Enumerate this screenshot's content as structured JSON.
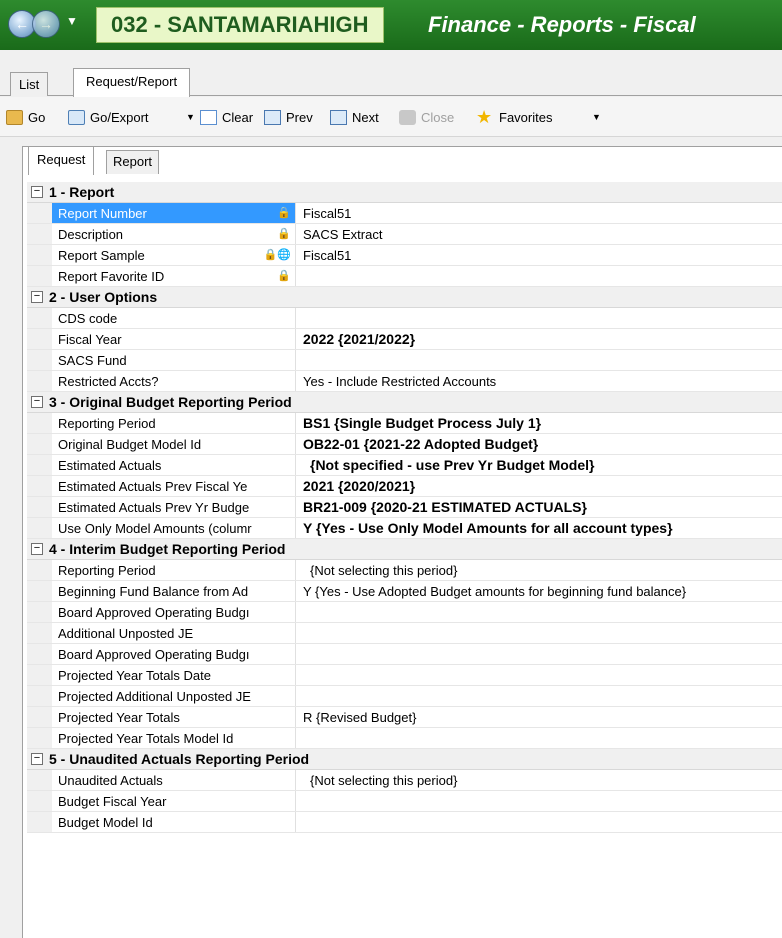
{
  "titlebar": {
    "district": "032 - SANTAMARIAHIGH",
    "module": "Finance - Reports - Fiscal",
    "back_icon": "back-arrow-icon",
    "forward_icon": "forward-arrow-icon"
  },
  "outer_tabs": {
    "list": "List",
    "request_report": "Request/Report"
  },
  "toolbar": {
    "go": "Go",
    "go_export": "Go/Export",
    "clear": "Clear",
    "prev": "Prev",
    "next": "Next",
    "close": "Close",
    "favorites": "Favorites"
  },
  "inner_tabs": {
    "request": "Request",
    "report": "Report"
  },
  "sections": {
    "s1": {
      "title": "1 - Report",
      "rows": [
        {
          "name": "Report Number",
          "value": "Fiscal51"
        },
        {
          "name": "Description",
          "value": "SACS Extract"
        },
        {
          "name": "Report Sample",
          "value": "Fiscal51"
        },
        {
          "name": "Report Favorite ID",
          "value": ""
        }
      ]
    },
    "s2": {
      "title": "2 - User Options",
      "rows": [
        {
          "name": "CDS code",
          "value": ""
        },
        {
          "name": "Fiscal Year",
          "value": "2022 {2021/2022}"
        },
        {
          "name": "SACS Fund",
          "value": ""
        },
        {
          "name": "Restricted Accts?",
          "value": "Yes - Include Restricted Accounts"
        }
      ]
    },
    "s3": {
      "title": "3 - Original Budget Reporting Period",
      "rows": [
        {
          "name": "Reporting Period",
          "value": "BS1 {Single Budget Process July 1}"
        },
        {
          "name": "Original Budget Model Id",
          "value": "OB22-01 {2021-22 Adopted Budget}"
        },
        {
          "name": "Estimated Actuals",
          "value": "{Not specified - use Prev Yr Budget Model}"
        },
        {
          "name": "Estimated Actuals Prev Fiscal Ye",
          "value": "2021 {2020/2021}"
        },
        {
          "name": "Estimated Actuals Prev Yr Budge",
          "value": "BR21-009 {2020-21 ESTIMATED ACTUALS}"
        },
        {
          "name": "Use Only Model Amounts (columr",
          "value": "Y {Yes - Use Only Model Amounts for all account types}"
        }
      ]
    },
    "s4": {
      "title": "4 - Interim Budget Reporting Period",
      "rows": [
        {
          "name": "Reporting Period",
          "value": "{Not selecting this period}"
        },
        {
          "name": "Beginning Fund Balance from Ad",
          "value": "Y {Yes - Use Adopted Budget amounts for beginning fund balance}"
        },
        {
          "name": "Board Approved Operating Budgı",
          "value": ""
        },
        {
          "name": "Additional Unposted JE",
          "value": ""
        },
        {
          "name": "Board Approved Operating Budgı",
          "value": ""
        },
        {
          "name": "Projected Year Totals Date",
          "value": ""
        },
        {
          "name": "Projected Additional Unposted JE",
          "value": ""
        },
        {
          "name": "Projected Year Totals",
          "value": "R {Revised Budget}"
        },
        {
          "name": "Projected Year Totals Model Id",
          "value": ""
        }
      ]
    },
    "s5": {
      "title": "5 - Unaudited Actuals Reporting Period",
      "rows": [
        {
          "name": "Unaudited Actuals",
          "value": "{Not selecting this period}"
        },
        {
          "name": "Budget Fiscal Year",
          "value": ""
        },
        {
          "name": "Budget Model Id",
          "value": ""
        }
      ]
    }
  },
  "colors": {
    "title_bg": "#1f7a1f",
    "district_bg": "#e9f7c8",
    "selection": "#3399ff"
  }
}
